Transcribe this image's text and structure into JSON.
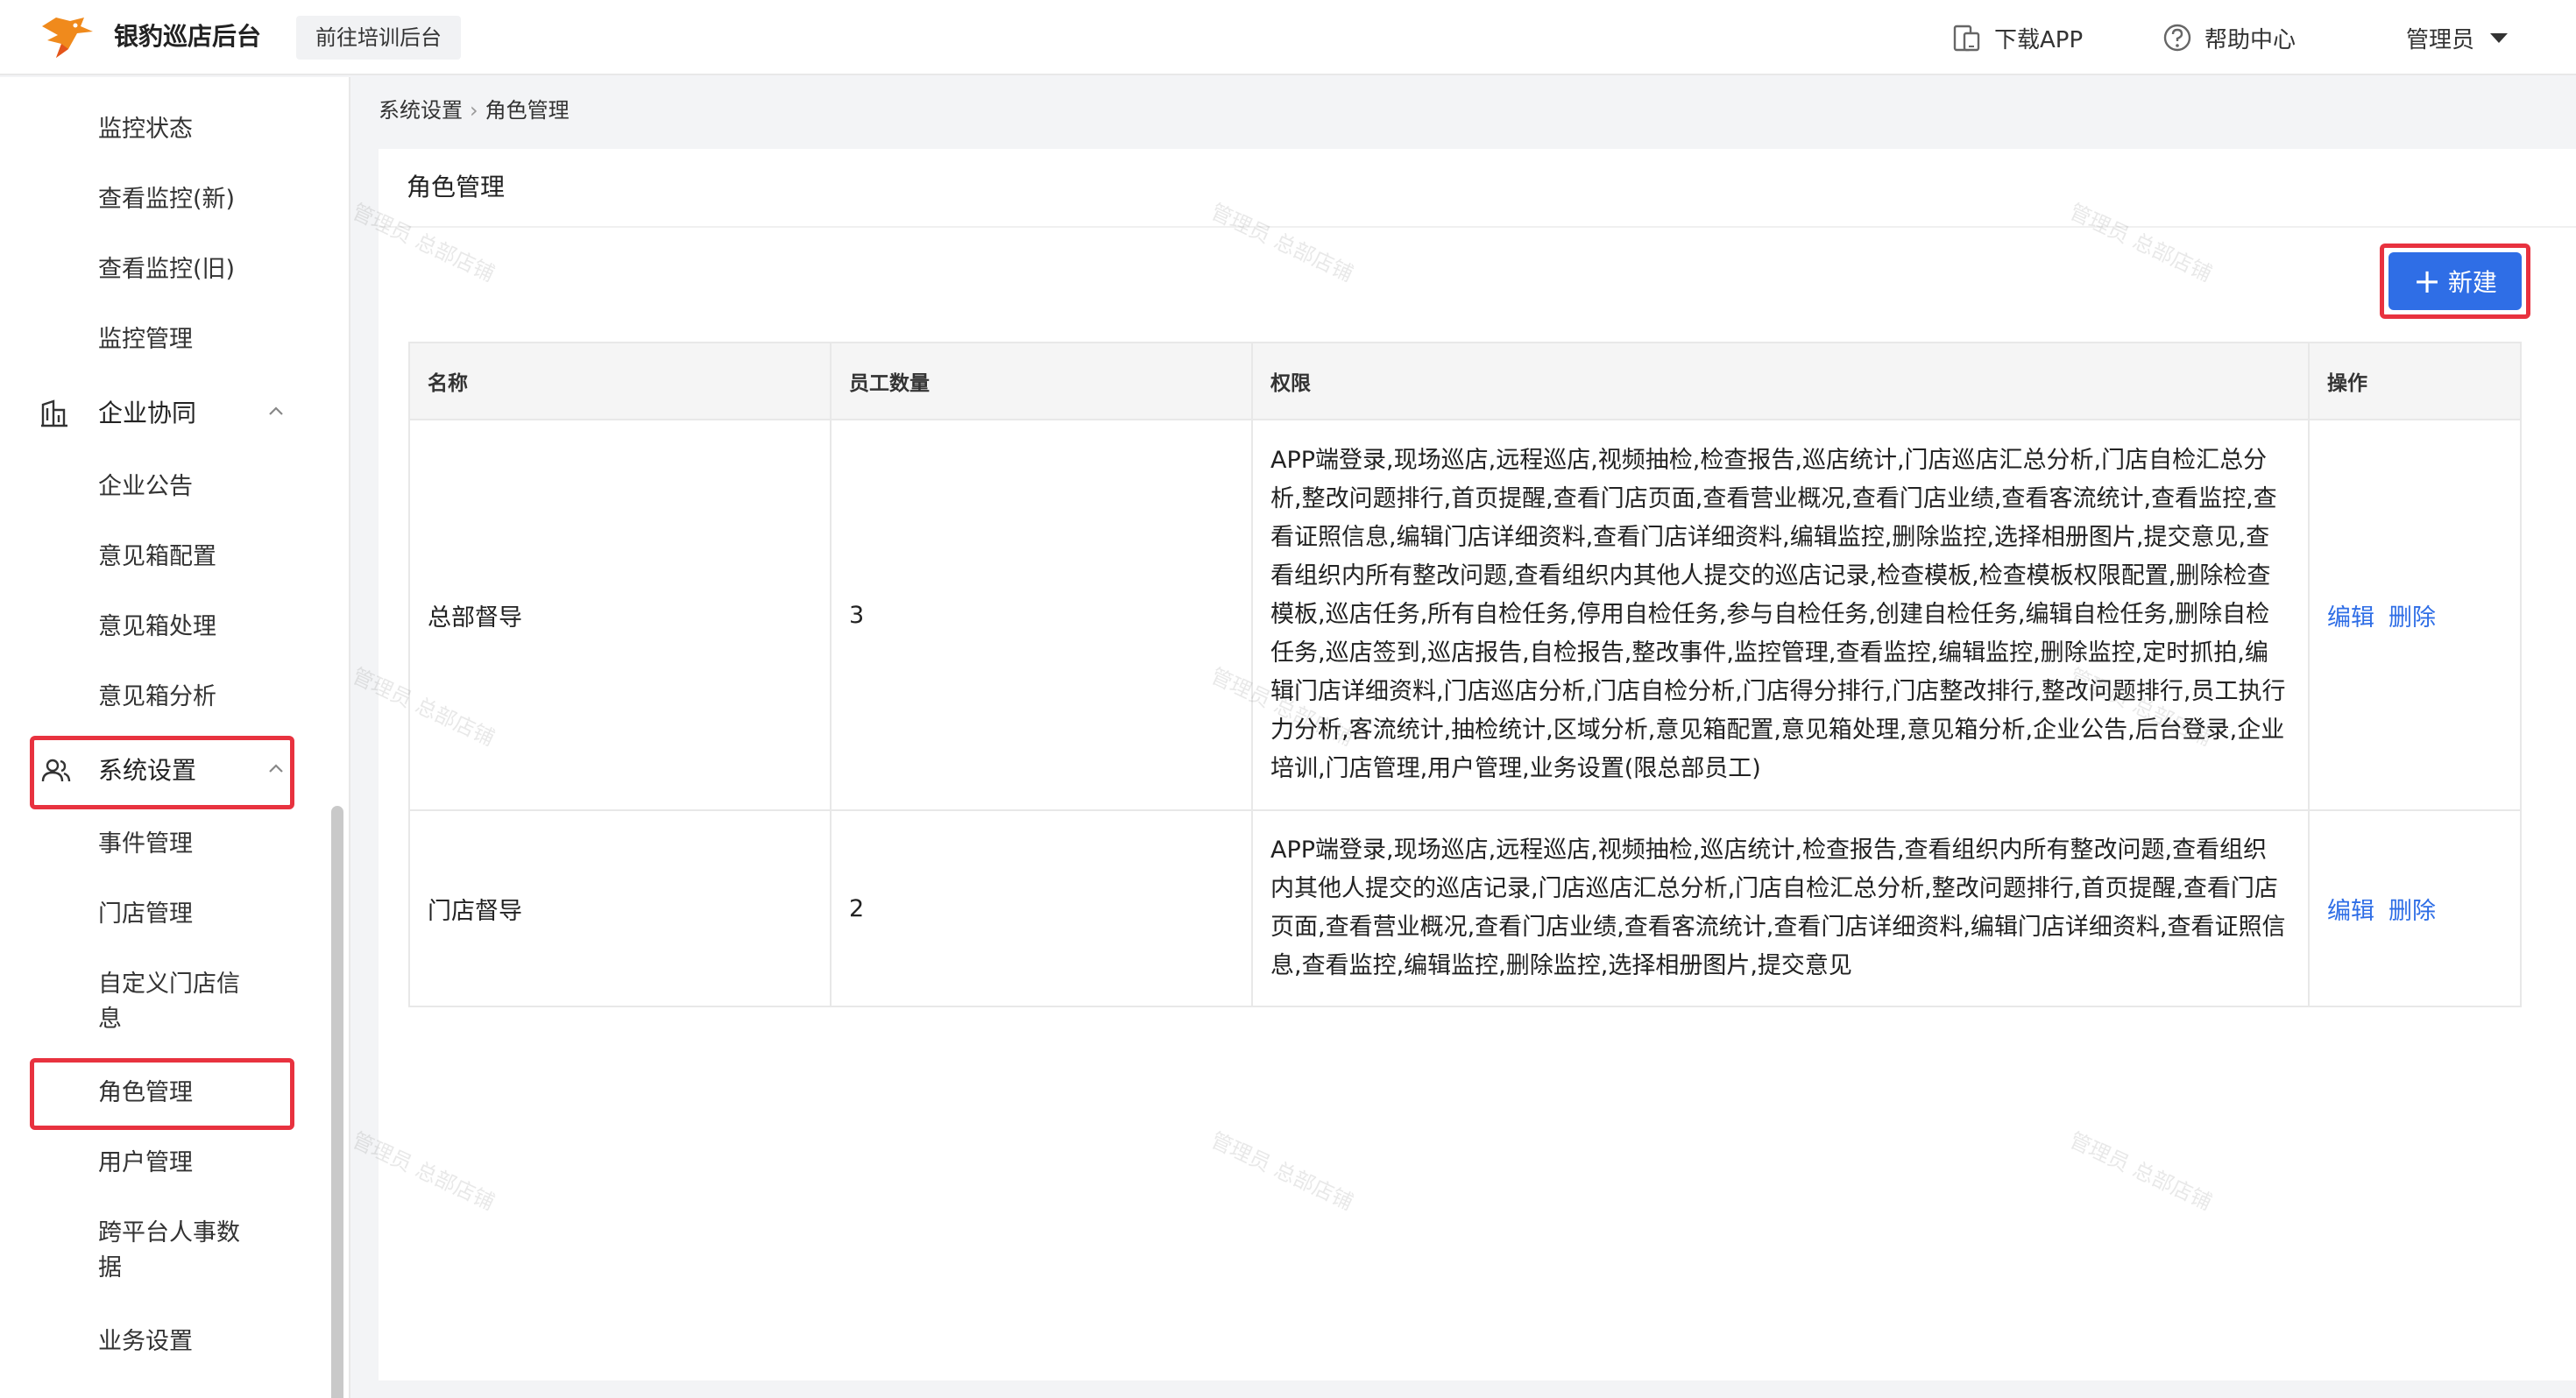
{
  "header": {
    "brand": "银豹巡店后台",
    "training_button": "前往培训后台",
    "download_app": "下载APP",
    "help_center": "帮助中心",
    "user_menu": "管理员"
  },
  "sidebar": {
    "items_top": [
      "监控状态",
      "查看监控(新)",
      "查看监控(旧)",
      "监控管理"
    ],
    "group_enterprise": "企业协同",
    "items_enterprise": [
      "企业公告",
      "意见箱配置",
      "意见箱处理",
      "意见箱分析"
    ],
    "group_system": "系统设置",
    "items_system": [
      "事件管理",
      "门店管理",
      "自定义门店信",
      "息",
      "角色管理",
      "用户管理",
      "跨平台人事数",
      "据",
      "业务设置"
    ]
  },
  "breadcrumb": {
    "parent": "系统设置",
    "sep": "›",
    "current": "角色管理"
  },
  "panel": {
    "title": "角色管理",
    "new_button": "新建",
    "new_button_icon": "plus-icon"
  },
  "table": {
    "columns": [
      "名称",
      "员工数量",
      "权限",
      "操作"
    ],
    "rows": [
      {
        "name": "总部督导",
        "count": "3",
        "permissions": "APP端登录,现场巡店,远程巡店,视频抽检,检查报告,巡店统计,门店巡店汇总分析,门店自检汇总分析,整改问题排行,首页提醒,查看门店页面,查看营业概况,查看门店业绩,查看客流统计,查看监控,查看证照信息,编辑门店详细资料,查看门店详细资料,编辑监控,删除监控,选择相册图片,提交意见,查看组织内所有整改问题,查看组织内其他人提交的巡店记录,检查模板,检查模板权限配置,删除检查模板,巡店任务,所有自检任务,停用自检任务,参与自检任务,创建自检任务,编辑自检任务,删除自检任务,巡店签到,巡店报告,自检报告,整改事件,监控管理,查看监控,编辑监控,删除监控,定时抓拍,编辑门店详细资料,门店巡店分析,门店自检分析,门店得分排行,门店整改排行,整改问题排行,员工执行力分析,客流统计,抽检统计,区域分析,意见箱配置,意见箱处理,意见箱分析,企业公告,后台登录,企业培训,门店管理,用户管理,业务设置(限总部员工)",
        "edit": "编辑",
        "delete": "删除"
      },
      {
        "name": "门店督导",
        "count": "2",
        "permissions": "APP端登录,现场巡店,远程巡店,视频抽检,巡店统计,检查报告,查看组织内所有整改问题,查看组织内其他人提交的巡店记录,门店巡店汇总分析,门店自检汇总分析,整改问题排行,首页提醒,查看门店页面,查看营业概况,查看门店业绩,查看客流统计,查看门店详细资料,编辑门店详细资料,查看证照信息,查看监控,编辑监控,删除监控,选择相册图片,提交意见",
        "edit": "编辑",
        "delete": "删除"
      }
    ]
  },
  "watermark": "管理员 总部店铺",
  "colors": {
    "primary": "#2f6ee6",
    "highlight": "#e8323f",
    "logo_orange": "#f08a1c"
  }
}
